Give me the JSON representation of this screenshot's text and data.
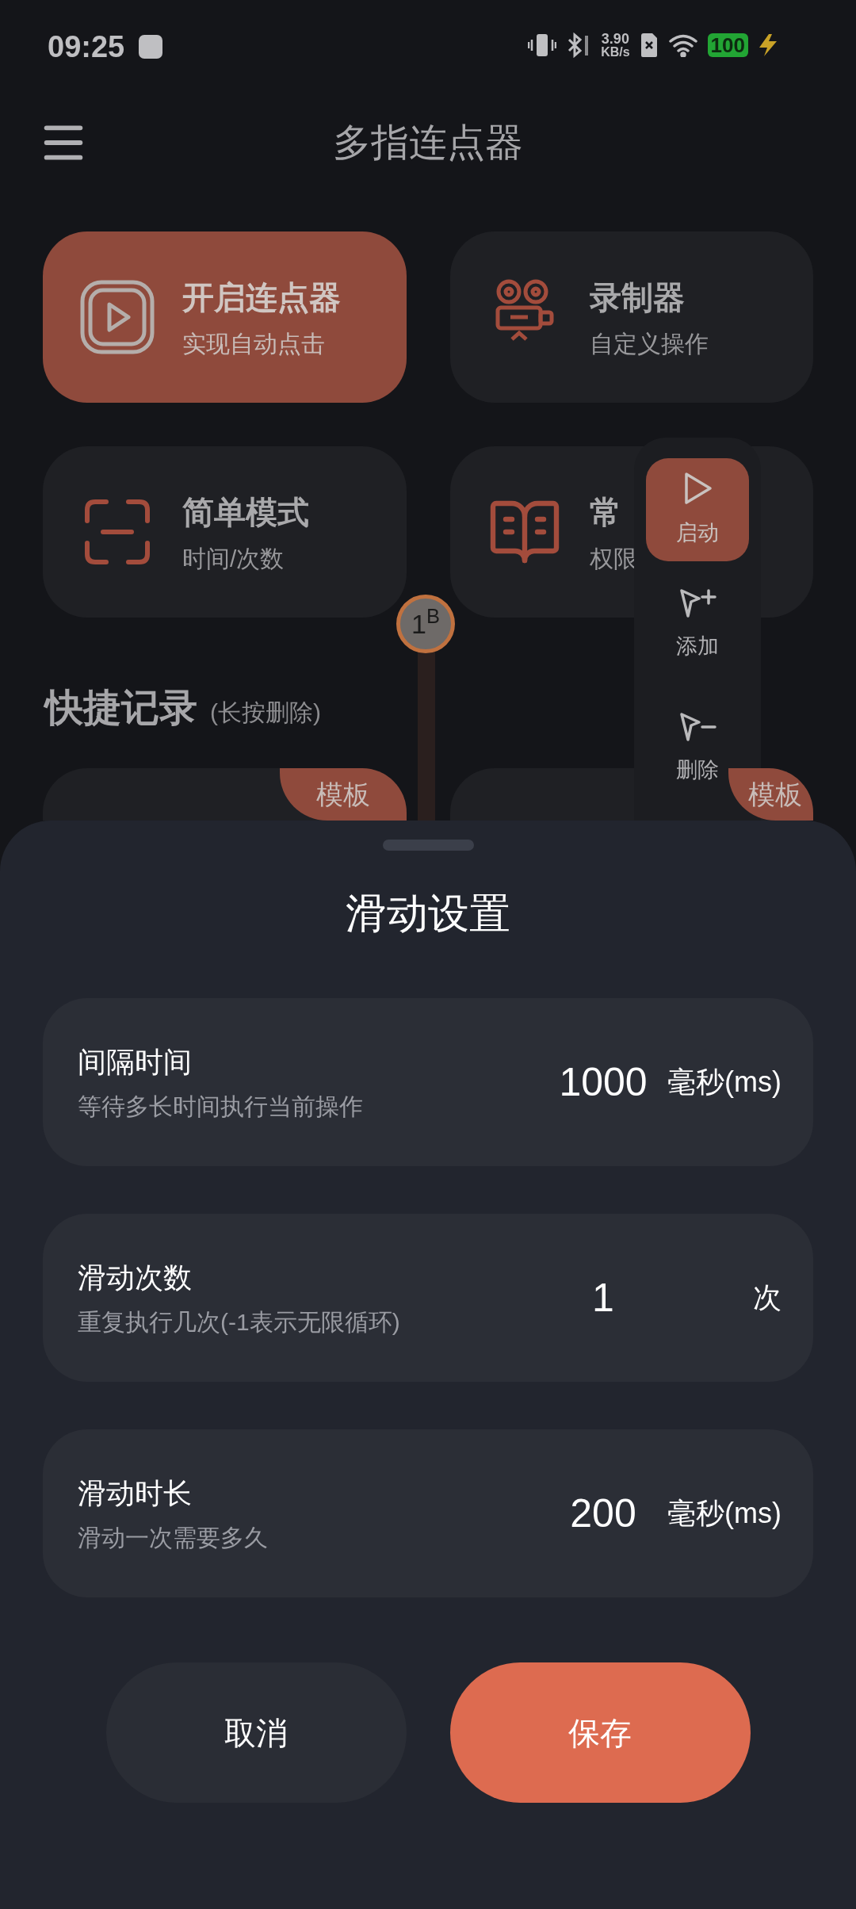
{
  "status_bar": {
    "time": "09:25",
    "net_speed_value": "3.90",
    "net_speed_unit": "KB/s",
    "battery": "100"
  },
  "header": {
    "title": "多指连点器"
  },
  "feature_cards": [
    {
      "title": "开启连点器",
      "subtitle": "实现自动点击",
      "selected": true
    },
    {
      "title": "录制器",
      "subtitle": "自定义操作",
      "selected": false
    },
    {
      "title": "简单模式",
      "subtitle": "时间/次数",
      "selected": false
    },
    {
      "title": "常",
      "subtitle": "权限",
      "selected": false
    }
  ],
  "floating_toolbar": {
    "items": [
      {
        "label": "启动",
        "selected": true
      },
      {
        "label": "添加",
        "selected": false
      },
      {
        "label": "删除",
        "selected": false
      }
    ]
  },
  "marker": {
    "label": "1$^{B}$"
  },
  "quick_records": {
    "title": "快捷记录",
    "hint": "(长按删除)",
    "items": [
      {
        "tag": "模板"
      },
      {
        "tag": "模板"
      }
    ]
  },
  "sheet": {
    "title": "滑动设置",
    "settings": [
      {
        "label": "间隔时间",
        "description": "等待多长时间执行当前操作",
        "value": "1000",
        "unit": "毫秒(ms)"
      },
      {
        "label": "滑动次数",
        "description": "重复执行几次(-1表示无限循环)",
        "value": "1",
        "unit": "次"
      },
      {
        "label": "滑动时长",
        "description": "滑动一次需要多久",
        "value": "200",
        "unit": "毫秒(ms)"
      }
    ],
    "buttons": [
      {
        "label": "取消",
        "kind": "secondary"
      },
      {
        "label": "保存",
        "kind": "primary"
      }
    ]
  }
}
